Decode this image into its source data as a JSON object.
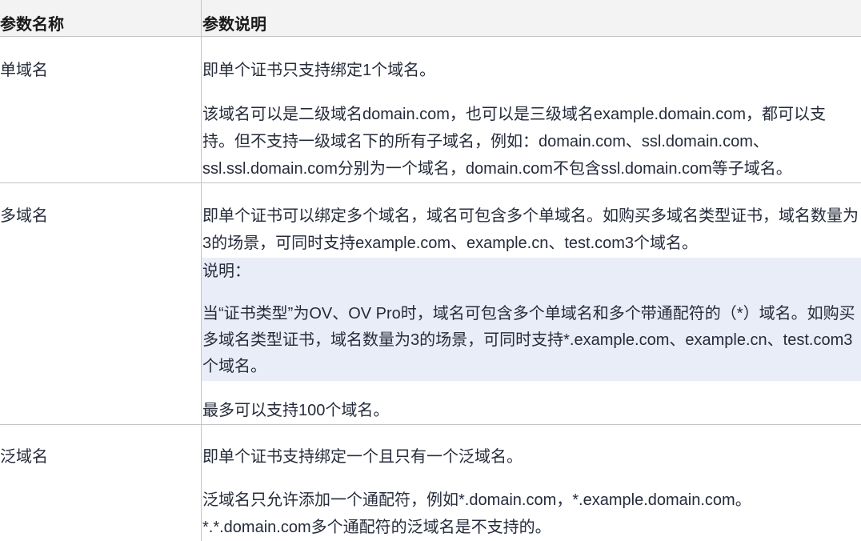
{
  "table": {
    "headers": [
      "参数名称",
      "参数说明"
    ],
    "rows": [
      {
        "name": "单域名",
        "paragraphs": [
          {
            "lines": [
              "即单个证书只支持绑定1个域名。"
            ]
          },
          {
            "lines": [
              "该域名可以是二级域名domain.com，也可以是三级域名example.domain.com，都可以支",
              "持。但不支持一级域名下的所有子域名，例如：domain.com、ssl.domain.com、",
              "ssl.ssl.domain.com分别为一个域名，domain.com不包含ssl.domain.com等子域名。"
            ]
          }
        ]
      },
      {
        "name": "多域名",
        "paragraphs": [
          {
            "lines": [
              "即单个证书可以绑定多个域名，域名可包含多个单域名。如购买多域名类型证书，域名数量为",
              "3的场景，可同时支持example.com、example.cn、test.com3个域名。"
            ]
          },
          {
            "lines": [
              "最多可以支持100个域名。"
            ]
          }
        ],
        "note": {
          "title": "说明：",
          "lines": [
            "当“证书类型”为OV、OV Pro时，域名可包含多个单域名和多个带通配符的（*）域名。如购买",
            "多域名类型证书，域名数量为3的场景，可同时支持*.example.com、example.cn、test.com3",
            "个域名。"
          ]
        }
      },
      {
        "name": "泛域名",
        "paragraphs": [
          {
            "lines": [
              "即单个证书支持绑定一个且只有一个泛域名。"
            ]
          },
          {
            "lines": [
              "泛域名只允许添加一个通配符，例如*.domain.com，*.example.domain.com。",
              "*.*.domain.com多个通配符的泛域名是不支持的。"
            ]
          }
        ]
      }
    ]
  },
  "colors": {
    "header_background": "#f3f3f3",
    "note_background": "#e9edf8",
    "border": "#c4c4c4",
    "text": "#252b3a",
    "header_text": "#191919"
  }
}
